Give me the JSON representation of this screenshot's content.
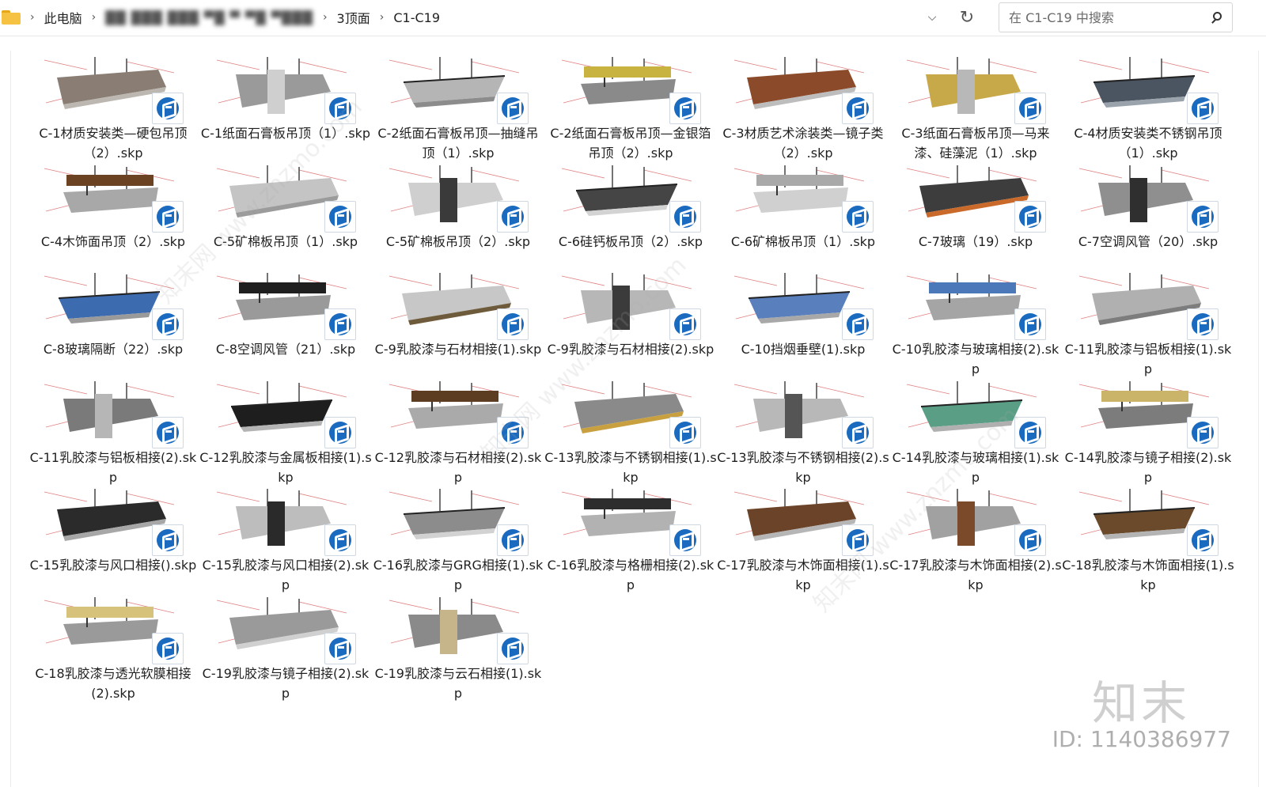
{
  "address_bar": {
    "crumbs": [
      "此电脑",
      "██ ███ ███ ▀█ ▀ ▀█ ▀███",
      "3顶面",
      "C1-C19"
    ],
    "search_placeholder": "在 C1-C19 中搜索"
  },
  "files": [
    {
      "name": "C-1材质安装类—硬包吊顶（2）.skp",
      "palette": [
        "#8a7e74",
        "#bcb7b0"
      ]
    },
    {
      "name": "C-1纸面石膏板吊顶（1）.skp",
      "palette": [
        "#cfcfcf",
        "#9a9a9a"
      ]
    },
    {
      "name": "C-2纸面石膏板吊顶—抽缝吊顶（1）.skp",
      "palette": [
        "#b5b5b5",
        "#8c8c8c"
      ]
    },
    {
      "name": "C-2纸面石膏板吊顶—金银箔吊顶（2）.skp",
      "palette": [
        "#c9b340",
        "#8a8a8a"
      ]
    },
    {
      "name": "C-3材质艺术涂装类—镜子类（2）.skp",
      "palette": [
        "#8b4a2a",
        "#bdbdbd"
      ]
    },
    {
      "name": "C-3纸面石膏板吊顶—马来漆、硅藻泥（1）.skp",
      "palette": [
        "#b8b8b8",
        "#c8a94a"
      ]
    },
    {
      "name": "C-4材质安装类不锈钢吊顶（1）.skp",
      "palette": [
        "#4a5561",
        "#9aa3ac"
      ]
    },
    {
      "name": "C-4木饰面吊顶（2）.skp",
      "palette": [
        "#6b4322",
        "#a8a8a8"
      ]
    },
    {
      "name": "C-5矿棉板吊顶（1）.skp",
      "palette": [
        "#c4c4c4",
        "#9b9b9b"
      ]
    },
    {
      "name": "C-5矿棉板吊顶（2）.skp",
      "palette": [
        "#3a3a3a",
        "#cfcfcf"
      ]
    },
    {
      "name": "C-6硅钙板吊顶（2）.skp",
      "palette": [
        "#454545",
        "#d3d3d3"
      ]
    },
    {
      "name": "C-6矿棉板吊顶（1）.skp",
      "palette": [
        "#a9a9a9",
        "#d0d0d0"
      ]
    },
    {
      "name": "C-7玻璃（19）.skp",
      "palette": [
        "#3d3d3d",
        "#c96a2b"
      ]
    },
    {
      "name": "C-7空调风管（20）.skp",
      "palette": [
        "#2f2f2f",
        "#8f8f8f"
      ]
    },
    {
      "name": "C-8玻璃隔断（22）.skp",
      "palette": [
        "#3d6bb0",
        "#9a9a9a"
      ]
    },
    {
      "name": "C-8空调风管（21）.skp",
      "palette": [
        "#1f1f1f",
        "#9a9a9a"
      ]
    },
    {
      "name": "C-9乳胶漆与石材相接(1).skp",
      "palette": [
        "#c7c7c7",
        "#6e5b3b"
      ]
    },
    {
      "name": "C-9乳胶漆与石材相接(2).skp",
      "palette": [
        "#3b3b3b",
        "#b7b7b7"
      ]
    },
    {
      "name": "C-10挡烟垂壁(1).skp",
      "palette": [
        "#5a7fbd",
        "#a8a8a8"
      ]
    },
    {
      "name": "C-10乳胶漆与玻璃相接(2).skp",
      "palette": [
        "#4a78b9",
        "#a5a5a5"
      ]
    },
    {
      "name": "C-11乳胶漆与铝板相接(1).skp",
      "palette": [
        "#b0b0b0",
        "#7d7d7d"
      ]
    },
    {
      "name": "C-11乳胶漆与铝板相接(2).skp",
      "palette": [
        "#b6b6b6",
        "#7a7a7a"
      ]
    },
    {
      "name": "C-12乳胶漆与金属板相接(1).skp",
      "palette": [
        "#1e1e1e",
        "#b4b4b4"
      ]
    },
    {
      "name": "C-12乳胶漆与石材相接(2).skp",
      "palette": [
        "#5c3d22",
        "#aaaaaa"
      ]
    },
    {
      "name": "C-13乳胶漆与不锈钢相接(1).skp",
      "palette": [
        "#8a8a8a",
        "#c8a040"
      ]
    },
    {
      "name": "C-13乳胶漆与不锈钢相接(2).skp",
      "palette": [
        "#555555",
        "#b8b8b8"
      ]
    },
    {
      "name": "C-14乳胶漆与玻璃相接(1).skp",
      "palette": [
        "#5a9e86",
        "#b0b0b0"
      ]
    },
    {
      "name": "C-14乳胶漆与镜子相接(2).skp",
      "palette": [
        "#c9b46a",
        "#7c7c7c"
      ]
    },
    {
      "name": "C-15乳胶漆与风口相接().skp",
      "palette": [
        "#2b2b2b",
        "#a7a7a7"
      ]
    },
    {
      "name": "C-15乳胶漆与风口相接(2).skp",
      "palette": [
        "#2a2a2a",
        "#bdbdbd"
      ]
    },
    {
      "name": "C-16乳胶漆与GRG相接(1).skp",
      "palette": [
        "#8c8c8c",
        "#d2d2d2"
      ]
    },
    {
      "name": "C-16乳胶漆与格栅相接(2).skp",
      "palette": [
        "#2d2d2d",
        "#b2b2b2"
      ]
    },
    {
      "name": "C-17乳胶漆与木饰面相接(1).skp",
      "palette": [
        "#6b4328",
        "#b6b6b6"
      ]
    },
    {
      "name": "C-17乳胶漆与木饰面相接(2).skp",
      "palette": [
        "#7a4a2a",
        "#a1a1a1"
      ]
    },
    {
      "name": "C-18乳胶漆与木饰面相接(1).skp",
      "palette": [
        "#6a4a2a",
        "#b4b4b4"
      ]
    },
    {
      "name": "C-18乳胶漆与透光软膜相接(2).skp",
      "palette": [
        "#d6c27a",
        "#9a9a9a"
      ]
    },
    {
      "name": "C-19乳胶漆与镜子相接(2).skp",
      "palette": [
        "#9a9a9a",
        "#d0d0d0"
      ]
    },
    {
      "name": "C-19乳胶漆与云石相接(1).skp",
      "palette": [
        "#c6b48a",
        "#8a8a8a"
      ]
    }
  ],
  "watermark": {
    "logo": "知末",
    "id_text": "ID: 1140386977",
    "diagonal": "知末网 www.znzmo.com"
  }
}
